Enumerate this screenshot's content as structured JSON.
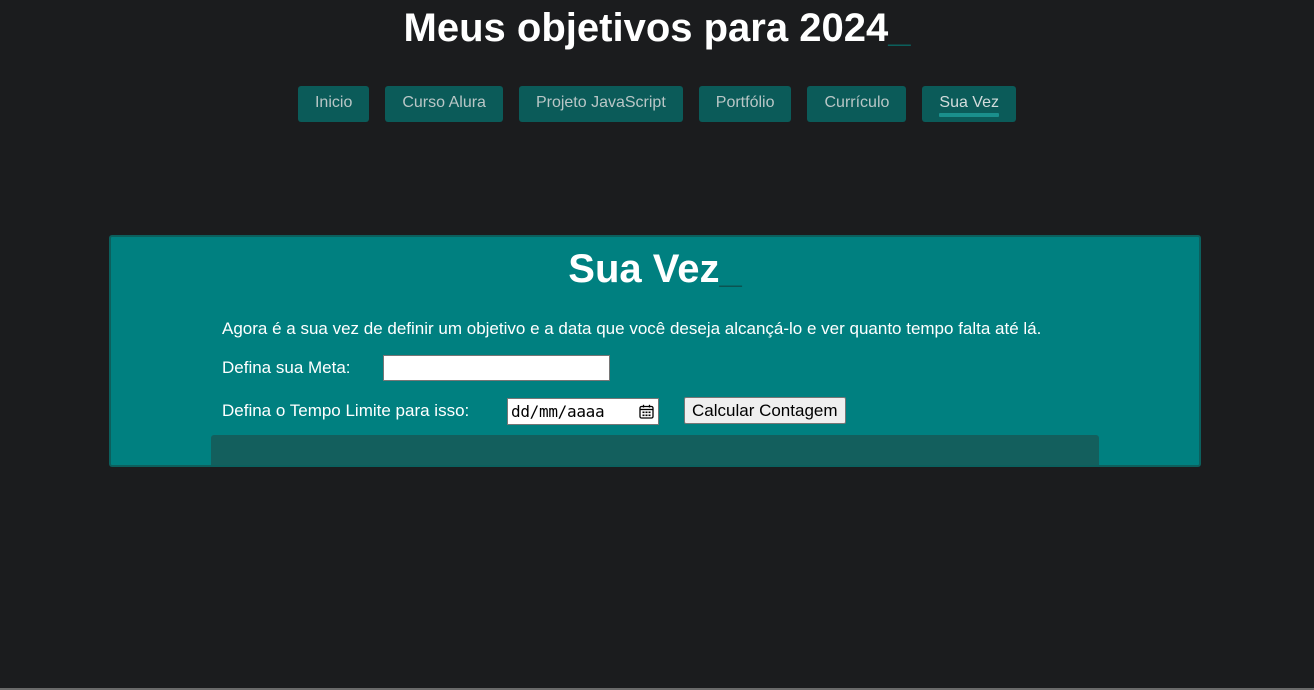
{
  "header": {
    "title": "Meus objetivos para 2024",
    "cursor": "_"
  },
  "nav": {
    "items": [
      {
        "label": "Inicio"
      },
      {
        "label": "Curso Alura"
      },
      {
        "label": "Projeto JavaScript"
      },
      {
        "label": "Portfólio"
      },
      {
        "label": "Currículo"
      },
      {
        "label": "Sua Vez"
      }
    ],
    "active": "Sua Vez"
  },
  "panel": {
    "title": "Sua Vez",
    "cursor": "_",
    "intro": "Agora é a sua vez de definir um objetivo e a data que você deseja alcançá-lo e ver quanto tempo falta até lá.",
    "goal_label": "Defina sua Meta:",
    "goal_value": "",
    "deadline_label": "Defina o Tempo Limite para isso:",
    "deadline_placeholder": "dd/mm/aaaa",
    "calculate_label": "Calcular Contagem",
    "result_text": ""
  },
  "colors": {
    "background": "#1b1c1e",
    "accent": "#008080",
    "nav_button": "#0b5b59",
    "result_box": "#135f5d"
  }
}
